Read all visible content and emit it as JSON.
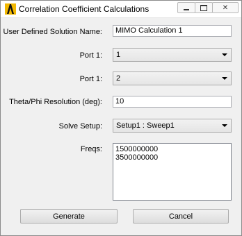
{
  "window": {
    "title": "Correlation Coefficient Calculations",
    "app_icon": "ansys-logo-icon"
  },
  "title_controls": {
    "minimize_icon": "minimize-icon",
    "maximize_icon": "maximize-icon",
    "close_icon": "close-icon",
    "close_glyph": "✕"
  },
  "form": {
    "solution_name_label": "User Defined Solution Name:",
    "solution_name_value": "MIMO Calculation 1",
    "port1_label": "Port 1:",
    "port1_value": "1",
    "port2_label": "Port 1:",
    "port2_value": "2",
    "resolution_label": "Theta/Phi Resolution (deg):",
    "resolution_value": "10",
    "solve_setup_label": "Solve Setup:",
    "solve_setup_value": "Setup1 : Sweep1",
    "freqs_label": "Freqs:",
    "freqs_values": [
      "1500000000",
      "3500000000"
    ]
  },
  "buttons": {
    "generate": "Generate",
    "cancel": "Cancel"
  },
  "colors": {
    "logo_yellow": "#f2b800",
    "logo_black": "#111111",
    "window_bg": "#f0f0f0"
  }
}
